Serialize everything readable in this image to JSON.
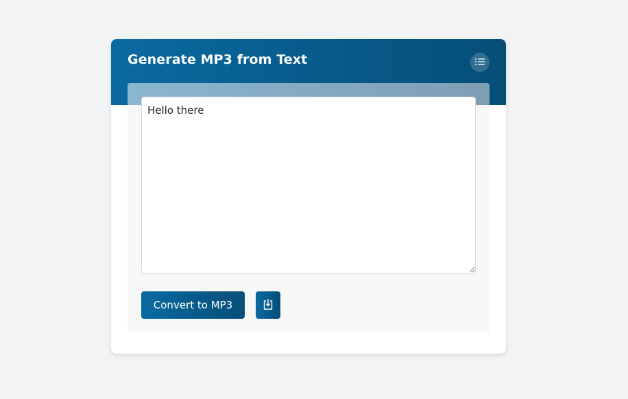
{
  "card": {
    "title": "Generate MP3 from Text",
    "menu_icon": "list-icon"
  },
  "editor": {
    "value": "Hello there"
  },
  "actions": {
    "convert_label": "Convert to MP3",
    "download_icon": "download-icon"
  },
  "colors": {
    "primary": "#075a8a",
    "background": "#f2f3f5",
    "panel": "#f7f7f8"
  }
}
